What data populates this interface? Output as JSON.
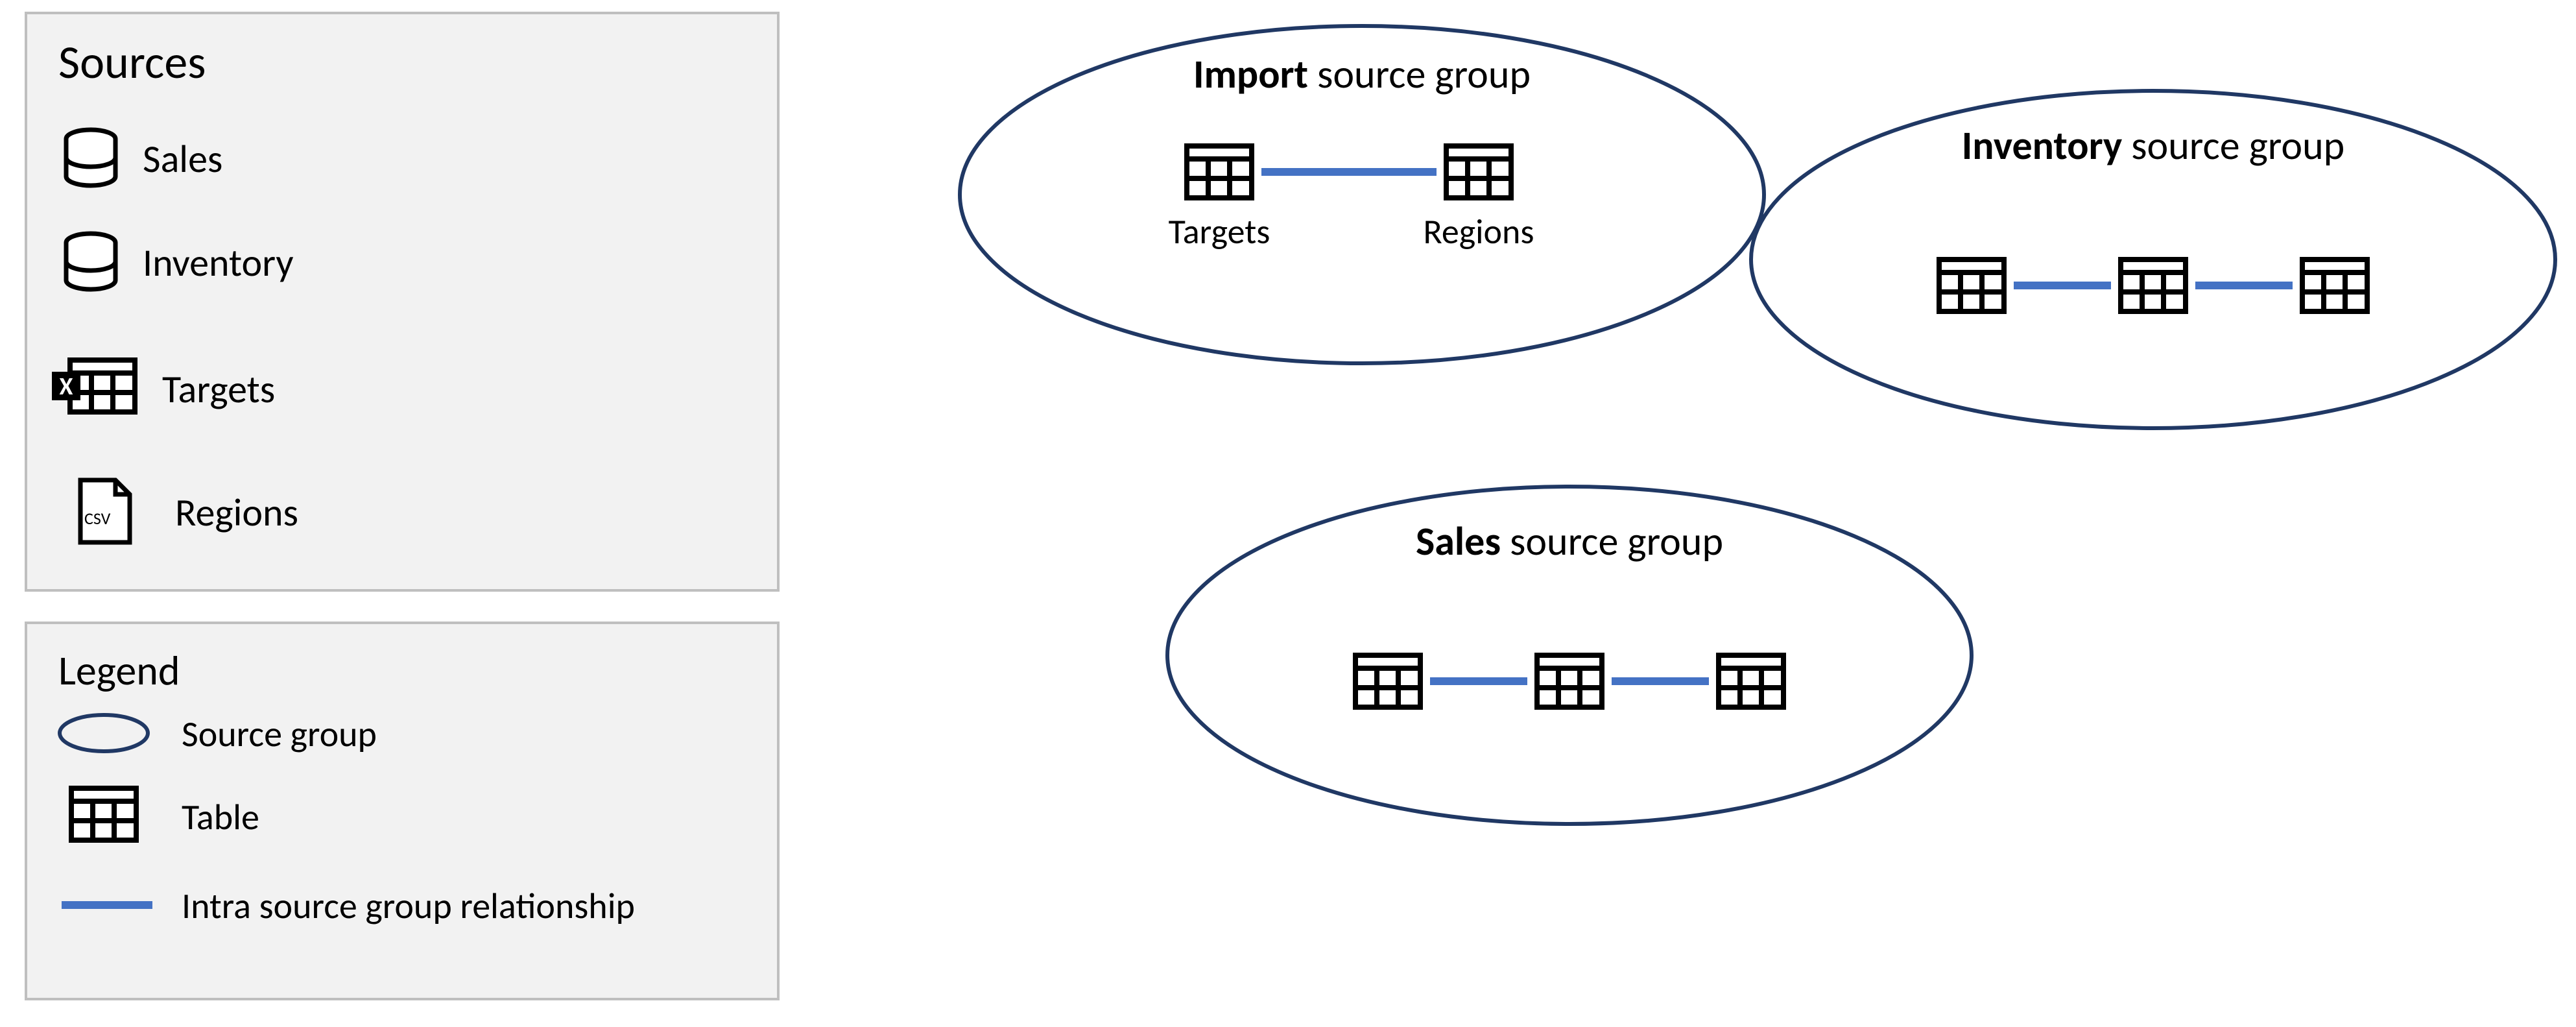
{
  "sources": {
    "title": "Sources",
    "items": [
      {
        "label": "Sales",
        "icon": "database"
      },
      {
        "label": "Inventory",
        "icon": "database"
      },
      {
        "label": "Targets",
        "icon": "excel"
      },
      {
        "label": "Regions",
        "icon": "csv"
      }
    ]
  },
  "legend": {
    "title": "Legend",
    "items": [
      {
        "label": "Source group",
        "symbol": "ellipse"
      },
      {
        "label": "Table",
        "symbol": "table"
      },
      {
        "label": "Intra source group relationship",
        "symbol": "line"
      }
    ]
  },
  "groups": {
    "import": {
      "title_bold": "Import",
      "title_rest": " source group",
      "tables": [
        {
          "label": "Targets"
        },
        {
          "label": "Regions"
        }
      ]
    },
    "inventory": {
      "title_bold": "Inventory",
      "title_rest": " source group",
      "table_count": 3
    },
    "sales": {
      "title_bold": "Sales",
      "title_rest": " source group",
      "table_count": 3
    }
  },
  "colors": {
    "panel_fill": "#f2f2f2",
    "panel_stroke": "#bfbfbf",
    "ellipse_stroke": "#203864",
    "relationship_line": "#4472C4",
    "icon_black": "#000000",
    "icon_white": "#ffffff"
  }
}
